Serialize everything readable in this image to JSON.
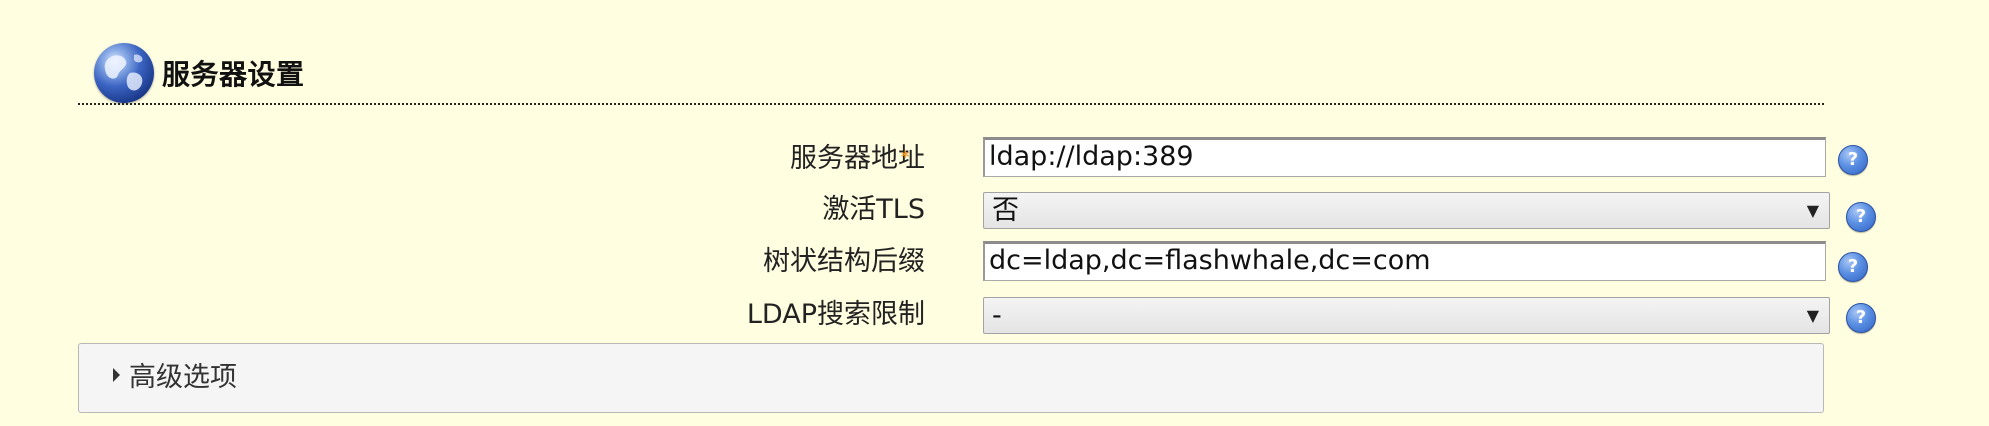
{
  "section": {
    "title": "服务器设置",
    "icon": "globe-icon"
  },
  "fields": {
    "server_address": {
      "label": "服务器地址",
      "required_mark": "*",
      "value": "ldap://ldap:389"
    },
    "activate_tls": {
      "label": "激活TLS",
      "selected": "否",
      "arrow": "▼"
    },
    "tree_suffix": {
      "label": "树状结构后缀",
      "value": "dc=ldap,dc=flashwhale,dc=com"
    },
    "ldap_search_limit": {
      "label": "LDAP搜索限制",
      "selected": "-",
      "arrow": "▼"
    }
  },
  "help": {
    "glyph": "?"
  },
  "advanced": {
    "label": "高级选项"
  },
  "colors": {
    "background": "#fffee0",
    "required": "#f29a2e",
    "help_icon": "#3b6fd6"
  }
}
